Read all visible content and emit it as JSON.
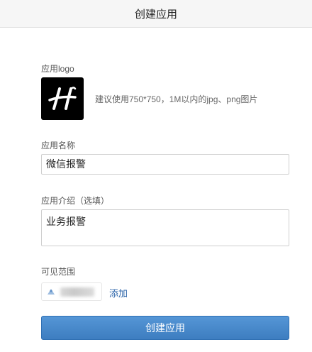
{
  "header": {
    "title": "创建应用"
  },
  "logo_section": {
    "label": "应用logo",
    "logo_glyph": "H",
    "logo_icon": "app-logo-icon",
    "hint": "建议使用750*750，1M以内的jpg、png图片"
  },
  "name_section": {
    "label": "应用名称",
    "value": "微信报警"
  },
  "intro_section": {
    "label": "应用介绍（选填）",
    "value": "业务报警"
  },
  "visibility_section": {
    "label": "可见范围",
    "add_label": "添加",
    "user_avatar_icon": "user-avatar-icon"
  },
  "actions": {
    "submit_label": "创建应用"
  },
  "colors": {
    "primary_button": "#4a8acb",
    "link": "#2a63a8",
    "header_bg": "#f6f6f6"
  }
}
